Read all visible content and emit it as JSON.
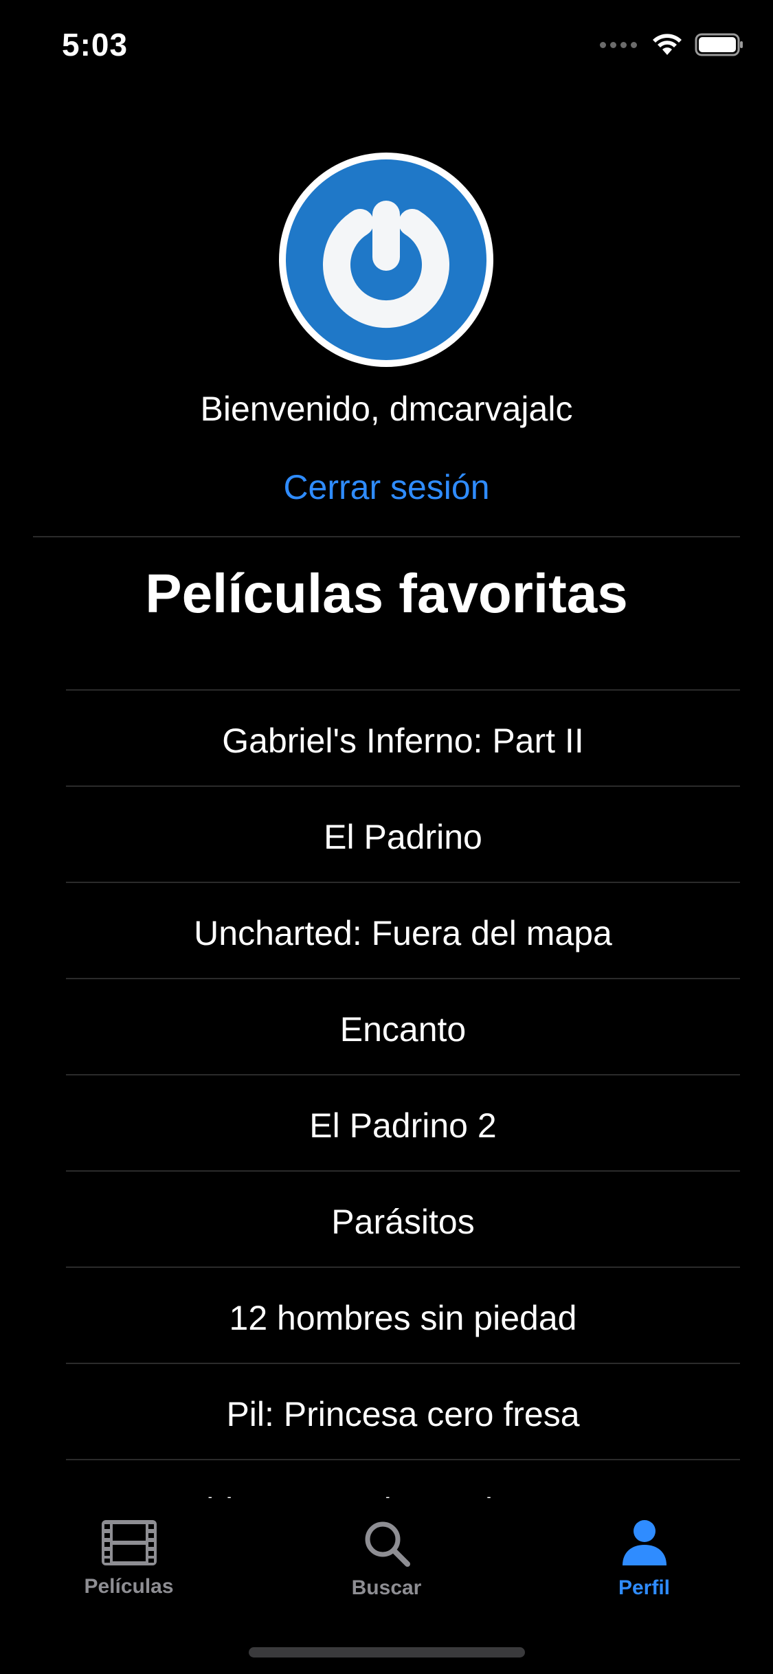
{
  "status_bar": {
    "time": "5:03",
    "icons": [
      "cellular-signal-icon",
      "wifi-icon",
      "battery-icon"
    ]
  },
  "profile": {
    "avatar_icon": "power-icon",
    "welcome_text": "Bienvenido, dmcarvajalc",
    "logout_label": "Cerrar sesión"
  },
  "favorites": {
    "title": "Películas favoritas",
    "items": [
      "Gabriel's Inferno: Part II",
      "El Padrino",
      "Uncharted: Fuera del mapa",
      "Encanto",
      "El Padrino 2",
      "Parásitos",
      "12 hombres sin piedad",
      "Pil: Princesa cero fresa",
      "Spider-Man: Sin camino a casa"
    ]
  },
  "tab_bar": {
    "tabs": [
      {
        "label": "Películas",
        "icon": "film-icon",
        "active": false
      },
      {
        "label": "Buscar",
        "icon": "search-icon",
        "active": false
      },
      {
        "label": "Perfil",
        "icon": "person-icon",
        "active": true
      }
    ]
  },
  "colors": {
    "background": "#000000",
    "accent": "#2f8cff",
    "inactive_tab": "#8e8e93",
    "avatar_blue": "#1f78c8",
    "separator": "#2b2b2b"
  }
}
